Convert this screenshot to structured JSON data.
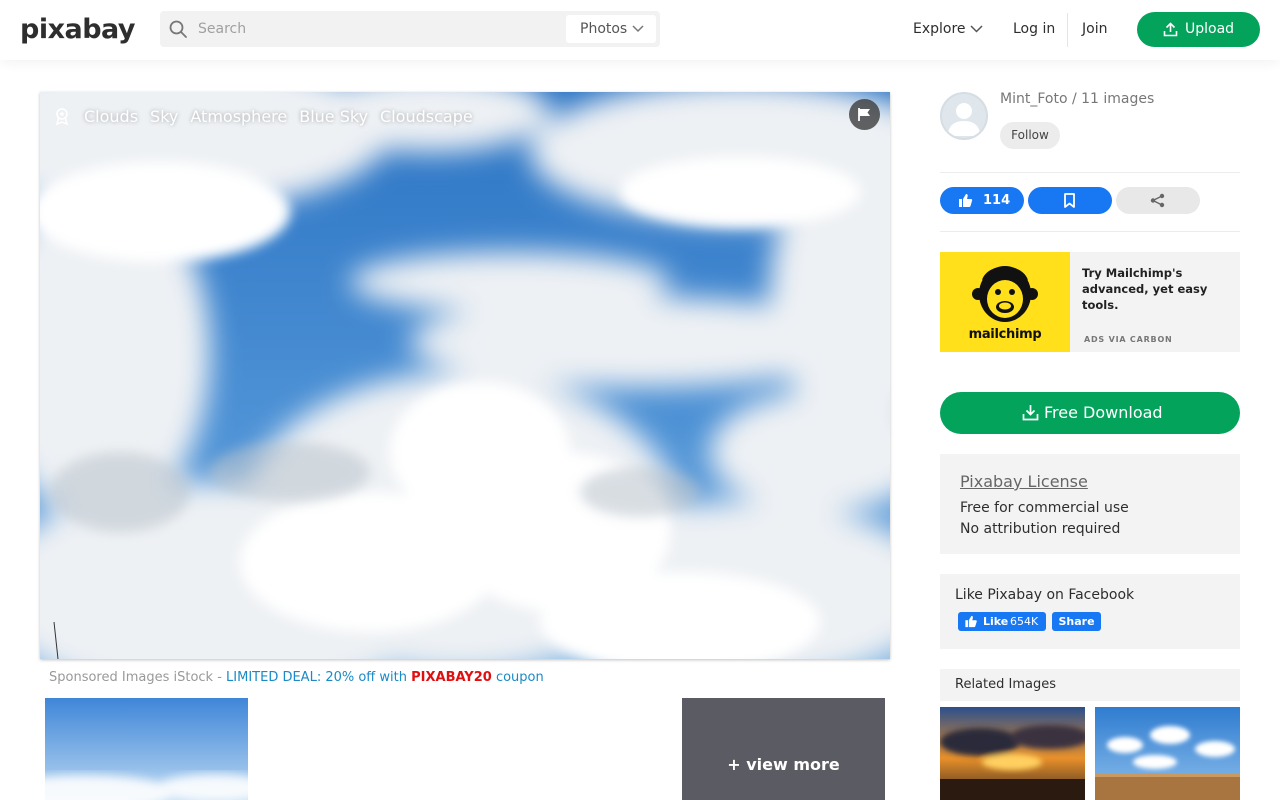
{
  "header": {
    "logo": "pixabay",
    "search_placeholder": "Search",
    "search_type": "Photos",
    "nav_explore": "Explore",
    "nav_login": "Log in",
    "nav_join": "Join",
    "upload_label": "Upload"
  },
  "photo": {
    "tags": [
      "Clouds",
      "Sky",
      "Atmosphere",
      "Blue Sky",
      "Cloudscape"
    ]
  },
  "sponsored": {
    "prefix": "Sponsored Images iStock - ",
    "deal": "LIMITED DEAL: 20% off with ",
    "code": "PIXABAY20",
    "suffix": " coupon",
    "view_more": "+ view more"
  },
  "sidebar": {
    "user_line": "Mint_Foto / 11 images",
    "follow_label": "Follow",
    "like_count": "114",
    "ad": {
      "brand": "mailchimp",
      "text": "Try Mailchimp's advanced, yet easy tools.",
      "via": "ADS VIA CARBON"
    },
    "download_label": "Free Download",
    "license": {
      "title": "Pixabay License",
      "line1": "Free for commercial use",
      "line2": "No attribution required"
    },
    "facebook": {
      "title": "Like Pixabay on Facebook",
      "like_label": "Like",
      "like_count": "654K",
      "share_label": "Share"
    },
    "related_title": "Related Images"
  },
  "colors": {
    "accent_green": "#04a35c",
    "facebook_blue": "#1877f2",
    "mailchimp_yellow": "#ffe01b",
    "deal_blue": "#1a8ac6",
    "code_red": "#e01010"
  }
}
